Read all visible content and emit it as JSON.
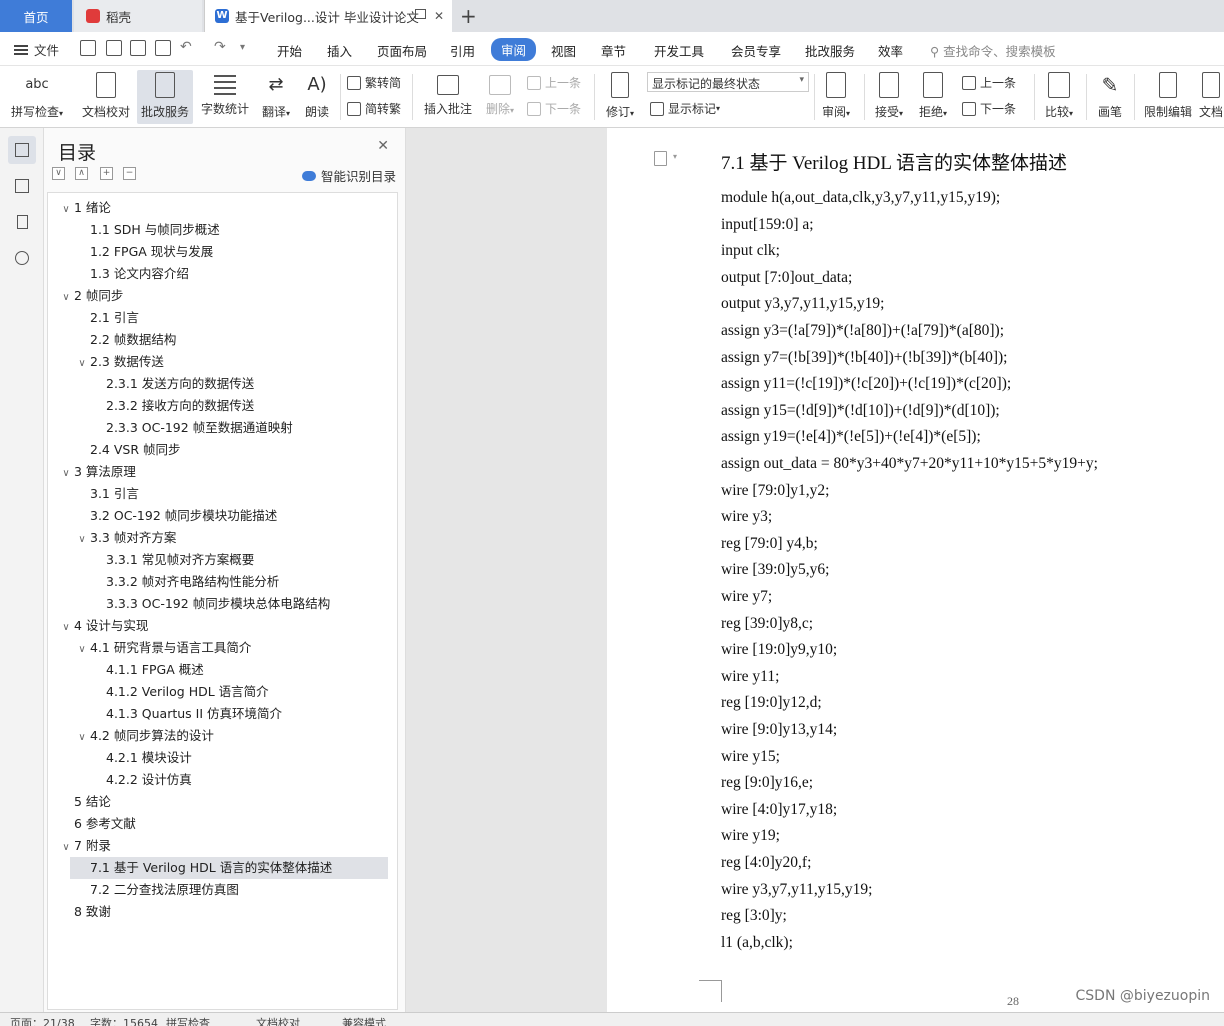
{
  "tabs": {
    "home": "首页",
    "daoke": "稻壳",
    "doc": "基于Verilog...设计 毕业设计论文",
    "close": "✕",
    "new": "+"
  },
  "menu": {
    "file": "文件",
    "items": [
      "开始",
      "插入",
      "页面布局",
      "引用",
      "审阅",
      "视图",
      "章节",
      "开发工具",
      "会员专享",
      "批改服务",
      "效率"
    ],
    "active": "审阅",
    "search": "查找命令、搜索模板"
  },
  "ribbon": {
    "spellcheck": "拼写检查",
    "doc_check": "文档校对",
    "review_service": "批改服务",
    "word_count": "字数统计",
    "translate": "翻译",
    "read_aloud": "朗读",
    "trad_simp": "繁转简",
    "simp_trad": "简转繁",
    "insert_comment": "插入批注",
    "delete": "删除",
    "prev_item": "上一条",
    "next_item": "下一条",
    "track": "修订",
    "markup_state": "显示标记的最终状态",
    "show_markup": "显示标记",
    "review": "审阅",
    "accept": "接受",
    "reject": "拒绝",
    "prev": "上一条",
    "next": "下一条",
    "compare": "比较",
    "pen": "画笔",
    "restrict_edit": "限制编辑",
    "doc_rights": "文档"
  },
  "toc": {
    "title": "目录",
    "smart": "智能识别目录",
    "items": [
      {
        "text": "1  绪论",
        "level": 0,
        "arrow": "∨"
      },
      {
        "text": "1.1 SDH 与帧同步概述",
        "level": 1,
        "arrow": ""
      },
      {
        "text": "1.2 FPGA 现状与发展",
        "level": 1,
        "arrow": ""
      },
      {
        "text": "1.3  论文内容介绍",
        "level": 1,
        "arrow": ""
      },
      {
        "text": "2  帧同步",
        "level": 0,
        "arrow": "∨"
      },
      {
        "text": "2.1  引言",
        "level": 1,
        "arrow": ""
      },
      {
        "text": "2.2  帧数据结构",
        "level": 1,
        "arrow": ""
      },
      {
        "text": "2.3 数据传送",
        "level": 1,
        "arrow": "∨"
      },
      {
        "text": "2.3.1  发送方向的数据传送",
        "level": 2,
        "arrow": ""
      },
      {
        "text": "2.3.2  接收方向的数据传送",
        "level": 2,
        "arrow": ""
      },
      {
        "text": "2.3.3 OC-192 帧至数据通道映射",
        "level": 2,
        "arrow": ""
      },
      {
        "text": "2.4 VSR 帧同步",
        "level": 1,
        "arrow": ""
      },
      {
        "text": "3  算法原理",
        "level": 0,
        "arrow": "∨"
      },
      {
        "text": "3.1  引言",
        "level": 1,
        "arrow": ""
      },
      {
        "text": "3.2 OC-192 帧同步模块功能描述",
        "level": 1,
        "arrow": ""
      },
      {
        "text": "3.3  帧对齐方案",
        "level": 1,
        "arrow": "∨"
      },
      {
        "text": "3.3.1  常见帧对齐方案概要",
        "level": 2,
        "arrow": ""
      },
      {
        "text": "3.3.2  帧对齐电路结构性能分析",
        "level": 2,
        "arrow": ""
      },
      {
        "text": "3.3.3 OC-192 帧同步模块总体电路结构",
        "level": 2,
        "arrow": ""
      },
      {
        "text": "4  设计与实现",
        "level": 0,
        "arrow": "∨"
      },
      {
        "text": "4.1 研究背景与语言工具简介",
        "level": 1,
        "arrow": "∨"
      },
      {
        "text": "4.1.1 FPGA 概述",
        "level": 2,
        "arrow": ""
      },
      {
        "text": "4.1.2 Verilog HDL 语言简介",
        "level": 2,
        "arrow": ""
      },
      {
        "text": "4.1.3 Quartus II 仿真环境简介",
        "level": 2,
        "arrow": ""
      },
      {
        "text": "4.2  帧同步算法的设计",
        "level": 1,
        "arrow": "∨"
      },
      {
        "text": "4.2.1  模块设计",
        "level": 2,
        "arrow": ""
      },
      {
        "text": "4.2.2  设计仿真",
        "level": 2,
        "arrow": ""
      },
      {
        "text": "5  结论",
        "level": 0,
        "arrow": ""
      },
      {
        "text": "6  参考文献",
        "level": 0,
        "arrow": ""
      },
      {
        "text": "7  附录",
        "level": 0,
        "arrow": "∨"
      },
      {
        "text": "7.1  基于 Verilog HDL 语言的实体整体描述",
        "level": 1,
        "arrow": "",
        "selected": true
      },
      {
        "text": "7.2  二分查找法原理仿真图",
        "level": 1,
        "arrow": ""
      },
      {
        "text": "8  致谢",
        "level": 0,
        "arrow": ""
      }
    ]
  },
  "document": {
    "heading": "7.1  基于 Verilog HDL 语言的实体整体描述",
    "lines": [
      "module h(a,out_data,clk,y3,y7,y11,y15,y19);",
      "input[159:0] a;",
      "input clk;",
      "output [7:0]out_data;",
      "output y3,y7,y11,y15,y19;",
      "assign y3=(!a[79])*(!a[80])+(!a[79])*(a[80]);",
      "assign y7=(!b[39])*(!b[40])+(!b[39])*(b[40]);",
      "assign y11=(!c[19])*(!c[20])+(!c[19])*(c[20]);",
      "assign y15=(!d[9])*(!d[10])+(!d[9])*(d[10]);",
      "assign y19=(!e[4])*(!e[5])+(!e[4])*(e[5]);",
      "assign out_data = 80*y3+40*y7+20*y11+10*y15+5*y19+y;",
      "wire [79:0]y1,y2;",
      "wire y3;",
      "reg [79:0] y4,b;",
      "wire [39:0]y5,y6;",
      "wire y7;",
      "reg [39:0]y8,c;",
      "wire [19:0]y9,y10;",
      "wire y11;",
      "reg [19:0]y12,d;",
      "wire [9:0]y13,y14;",
      "wire y15;",
      "reg [9:0]y16,e;",
      "wire [4:0]y17,y18;",
      "wire y19;",
      "reg [4:0]y20,f;",
      "wire y3,y7,y11,y15,y19;",
      "reg [3:0]y;",
      "l1 (a,b,clk);"
    ],
    "page_number": "28",
    "watermark": "CSDN @biyezuopin"
  },
  "status": {
    "page": "页面：21/38",
    "words": "字数：15654",
    "spellcheck": "拼写检查",
    "doccheck": "文档校对",
    "compat": "兼容模式"
  }
}
